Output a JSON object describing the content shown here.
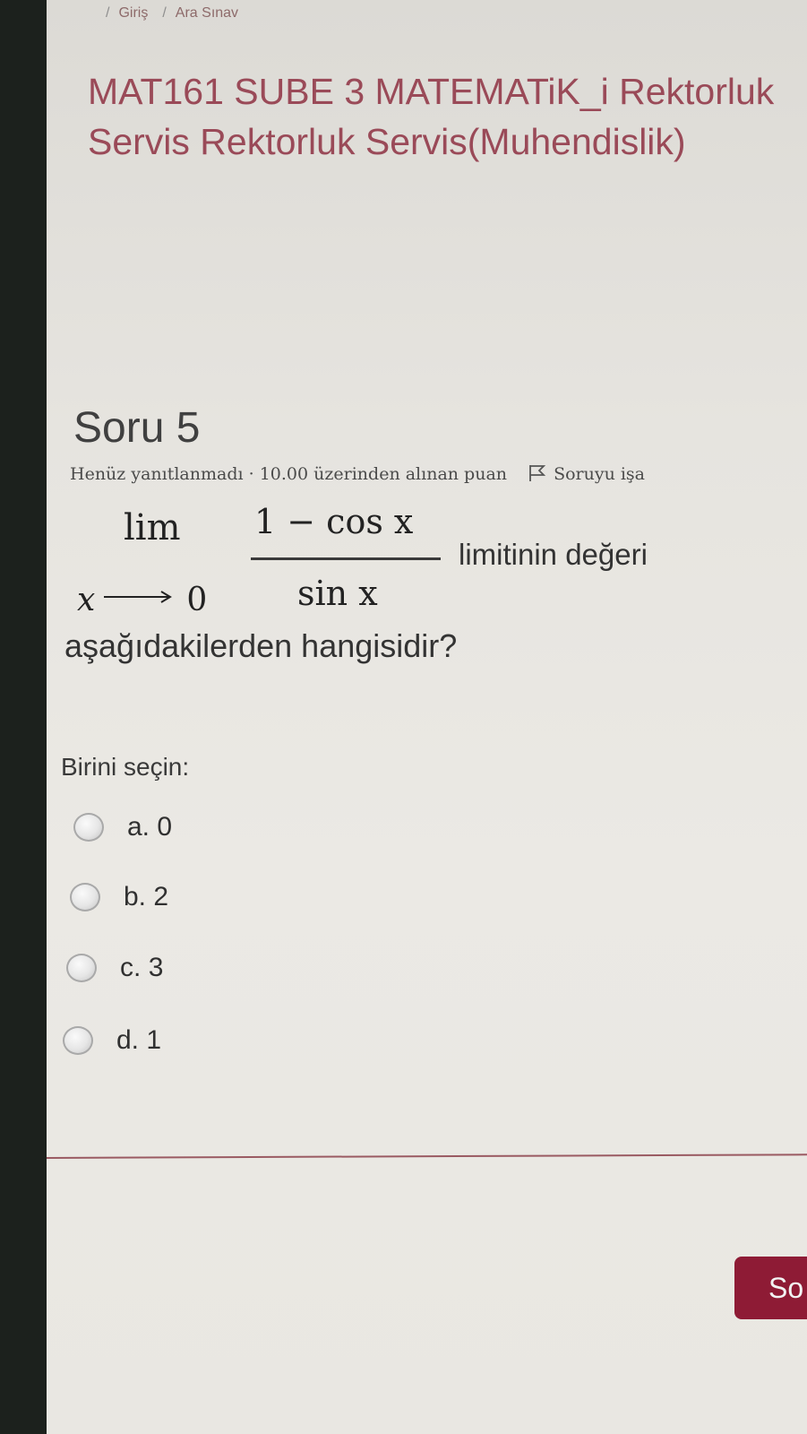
{
  "breadcrumb": {
    "items": [
      "Giriş",
      "Ara Sınav"
    ]
  },
  "course": {
    "title": "MAT161 SUBE 3 MATEMATiK_i Rektorluk Servis Rektorluk Servis(Muhendislik)"
  },
  "question": {
    "title": "Soru 5",
    "status": "Henüz yanıtlanmadı",
    "grade": "10.00 üzerinden alınan puan",
    "flag_label": "Soruyu işa",
    "limit": {
      "operator": "lim",
      "variable": "x",
      "target": "0",
      "numerator": "1 − cos x",
      "denominator": "sin x"
    },
    "text_after_formula": "limitinin değeri",
    "text_continued": "aşağıdakilerden hangisidir?",
    "prompt": "Birini seçin:",
    "options": [
      {
        "letter": "a.",
        "value": "0",
        "selected": false
      },
      {
        "letter": "b.",
        "value": "2",
        "selected": false
      },
      {
        "letter": "c.",
        "value": "3",
        "selected": false
      },
      {
        "letter": "d.",
        "value": "1",
        "selected": false
      }
    ]
  },
  "navigation": {
    "next_label": "So"
  },
  "colors": {
    "accent": "#8e1b35",
    "title": "#9a4a58"
  }
}
